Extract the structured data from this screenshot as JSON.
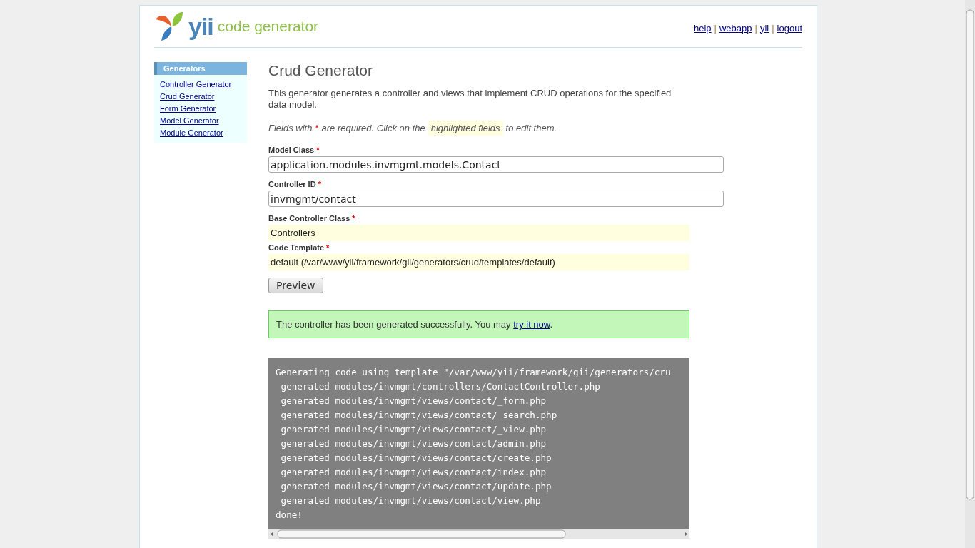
{
  "header": {
    "logo_word": "yii",
    "logo_text": "code generator",
    "links": [
      "help",
      "webapp",
      "yii",
      "logout"
    ],
    "separator": "|"
  },
  "sidebar": {
    "title": "Generators",
    "items": [
      {
        "label": "Controller Generator"
      },
      {
        "label": "Crud Generator"
      },
      {
        "label": "Form Generator"
      },
      {
        "label": "Model Generator"
      },
      {
        "label": "Module Generator"
      }
    ]
  },
  "main": {
    "title": "Crud Generator",
    "description": "This generator generates a controller and views that implement CRUD operations for the specified data model.",
    "hint": {
      "before": "Fields with",
      "star": "*",
      "middle": "are required. Click on the",
      "highlight": "highlighted fields",
      "after": "to edit them."
    },
    "fields": [
      {
        "kind": "input",
        "label": "Model Class",
        "required": "*",
        "value": "application.modules.invmgmt.models.Contact"
      },
      {
        "kind": "input",
        "label": "Controller ID",
        "required": "*",
        "value": "invmgmt/contact"
      },
      {
        "kind": "sticky",
        "label": "Base Controller Class",
        "required": "*",
        "value": "Controllers"
      },
      {
        "kind": "sticky",
        "label": "Code Template",
        "required": "*",
        "value": "default (/var/www/yii/framework/gii/generators/crud/templates/default)"
      }
    ],
    "button": "Preview",
    "success": {
      "text": "The controller has been generated successfully. You may",
      "link": "try it now",
      "end": "."
    },
    "log": [
      "Generating code using template \"/var/www/yii/framework/gii/generators/cru",
      " generated modules/invmgmt/controllers/ContactController.php",
      " generated modules/invmgmt/views/contact/_form.php",
      " generated modules/invmgmt/views/contact/_search.php",
      " generated modules/invmgmt/views/contact/_view.php",
      " generated modules/invmgmt/views/contact/admin.php",
      " generated modules/invmgmt/views/contact/create.php",
      " generated modules/invmgmt/views/contact/index.php",
      " generated modules/invmgmt/views/contact/update.php",
      " generated modules/invmgmt/views/contact/view.php",
      "done!"
    ]
  }
}
